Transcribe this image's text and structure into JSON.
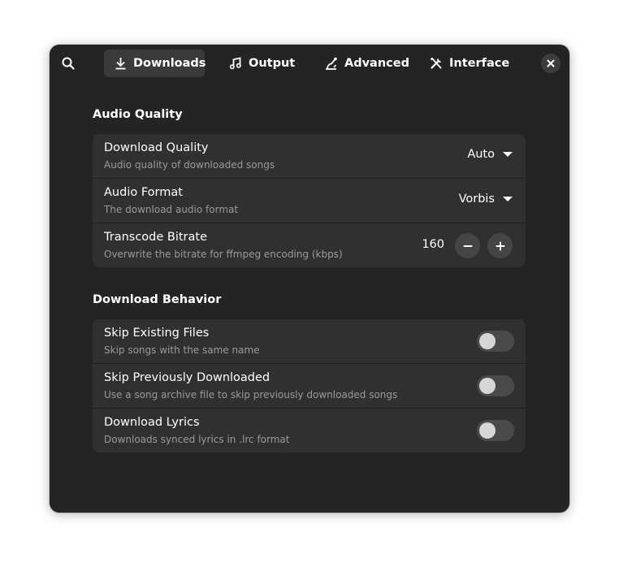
{
  "header": {
    "tabs": [
      {
        "label": "Downloads",
        "icon": "download-icon",
        "active": true
      },
      {
        "label": "Output",
        "icon": "music-note-icon",
        "active": false
      },
      {
        "label": "Advanced",
        "icon": "advanced-icon",
        "active": false
      },
      {
        "label": "Interface",
        "icon": "tools-icon",
        "active": false
      }
    ]
  },
  "sections": {
    "audio_quality": {
      "title": "Audio Quality",
      "rows": {
        "download_quality": {
          "title": "Download Quality",
          "subtitle": "Audio quality of downloaded songs",
          "value": "Auto"
        },
        "audio_format": {
          "title": "Audio Format",
          "subtitle": "The download audio format",
          "value": "Vorbis"
        },
        "transcode_bitrate": {
          "title": "Transcode Bitrate",
          "subtitle": "Overwrite the bitrate for ffmpeg encoding (kbps)",
          "value": "160"
        }
      }
    },
    "download_behavior": {
      "title": "Download Behavior",
      "rows": {
        "skip_existing": {
          "title": "Skip Existing Files",
          "subtitle": "Skip songs with the same name",
          "enabled": false
        },
        "skip_previous": {
          "title": "Skip Previously Downloaded",
          "subtitle": "Use a song archive file to skip previously downloaded songs",
          "enabled": false
        },
        "download_lyrics": {
          "title": "Download Lyrics",
          "subtitle": "Downloads synced lyrics in .lrc format",
          "enabled": false
        }
      }
    }
  },
  "colors": {
    "window_bg": "#242424",
    "group_bg": "#303030",
    "accent": "#ffffff"
  }
}
